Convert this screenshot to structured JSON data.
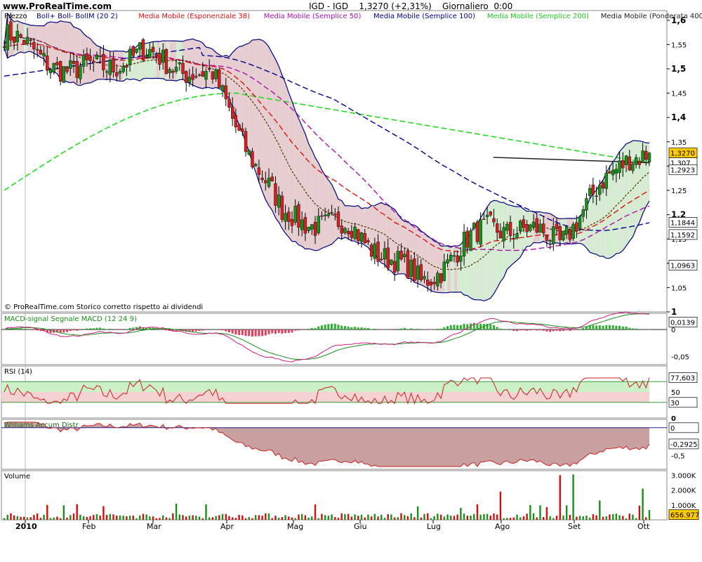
{
  "header": {
    "site": "www.ProRealTime.com",
    "symbol": "IGD - IGD",
    "last": "1,3270 (+2,31%)",
    "period": "Giornaliero",
    "time": "0:00"
  },
  "copyright": "© ProRealTime.com  Storico corretto rispetto ai dividendi",
  "colors": {
    "up": "#1a8f1a",
    "down": "#d42020",
    "bollinger": "#000080",
    "band_fill_up": "#d6ecd2",
    "band_fill_down": "#e6cdd0",
    "ema38": "#dd1111",
    "sma50": "#b010b0",
    "sma100": "#000090",
    "sma200": "#22dd22",
    "wma400": "#222222",
    "bb_mid": "#553300",
    "macd_line": "#d02080",
    "macd_signal": "#1a8f1a",
    "hist_pos": "#30b030",
    "hist_neg": "#e04060",
    "rsi_line": "#cc2020",
    "rsi_band": "#3a9a3a",
    "wad_line": "#cc2020",
    "wad_fill": "#c8a0a0",
    "volume_up": "#1a8f1a",
    "volume_down": "#cc1010",
    "price_tag": "#ffcc00"
  },
  "chart_data": [
    {
      "type": "candlestick",
      "name": "Prezzo",
      "legend": [
        {
          "text": "Boll+ Boll- BollM (20 2)",
          "color": "#000080"
        },
        {
          "text": "Media Mobile (Esponenziale 38)",
          "color": "#dd1111"
        },
        {
          "text": "Media Mobile (Semplice 50)",
          "color": "#b010b0"
        },
        {
          "text": "Media Mobile (Semplice 100)",
          "color": "#000090"
        },
        {
          "text": "Media Mobile (Semplice 200)",
          "color": "#22cc22"
        },
        {
          "text": "Media Mobile (Ponderata 400)",
          "color": "#222222"
        }
      ],
      "x_labels": [
        "2010",
        "Feb",
        "Mar",
        "Apr",
        "Mag",
        "Giu",
        "Lug",
        "Ago",
        "Set",
        "Ott"
      ],
      "y_ticks": [
        "1,6",
        "1,55",
        "1,5",
        "1,45",
        "1,4",
        "1,35",
        "1,3",
        "1,25",
        "1,2",
        "1,15",
        "1,1",
        "1,05",
        "1"
      ],
      "ylim": [
        1.0,
        1.62
      ],
      "price_tags": [
        {
          "label": "1,3270",
          "value": 1.327,
          "highlight": true
        },
        {
          "label": "1,307",
          "value": 1.307,
          "highlight": false
        },
        {
          "label": "1,2923",
          "value": 1.2923,
          "highlight": false
        },
        {
          "label": "1,1844",
          "value": 1.1844,
          "highlight": false
        },
        {
          "label": "1,1592",
          "value": 1.1592,
          "highlight": false
        },
        {
          "label": "1,0963",
          "value": 1.0963,
          "highlight": false
        }
      ],
      "close_path": [
        {
          "month": "2010",
          "close": 1.57
        },
        {
          "month": "Feb",
          "close": 1.49
        },
        {
          "month": "Mar",
          "close": 1.53
        },
        {
          "month": "Apr",
          "close": 1.48
        },
        {
          "month": "Mag",
          "close": 1.2
        },
        {
          "month": "Giu",
          "close": 1.17
        },
        {
          "month": "Lug",
          "close": 1.06
        },
        {
          "month": "Ago",
          "close": 1.18
        },
        {
          "month": "Set",
          "close": 1.15
        },
        {
          "month": "Ott",
          "close": 1.327
        }
      ]
    },
    {
      "type": "line",
      "name": "MACD-signal Segnale MACD (12 24 9)",
      "y_ticks": [
        "0",
        "-0,05"
      ],
      "ylim": [
        -0.065,
        0.03
      ],
      "tags": [
        {
          "label": "0,0139",
          "value": 0.0139
        }
      ]
    },
    {
      "type": "line",
      "name": "RSI (14)",
      "y_ticks": [
        "50",
        "0"
      ],
      "ylim": [
        0,
        100
      ],
      "bands": [
        30,
        70
      ],
      "tags": [
        {
          "label": "77,603",
          "value": 77.603
        },
        {
          "label": "30",
          "value": 30
        }
      ]
    },
    {
      "type": "area",
      "name": "Williams Accum Distr",
      "y_ticks": [
        "0",
        "-0,5"
      ],
      "ylim": [
        -0.75,
        0.15
      ],
      "tags": [
        {
          "label": "0",
          "value": 0
        },
        {
          "label": "-0,2925",
          "value": -0.2925
        }
      ]
    },
    {
      "type": "bar",
      "name": "Volume",
      "y_ticks": [
        "3.000K",
        "2.000K",
        "1.000K"
      ],
      "ylim": [
        0,
        3300
      ],
      "tags": [
        {
          "label": "656.977",
          "value": 656.977
        }
      ]
    }
  ]
}
